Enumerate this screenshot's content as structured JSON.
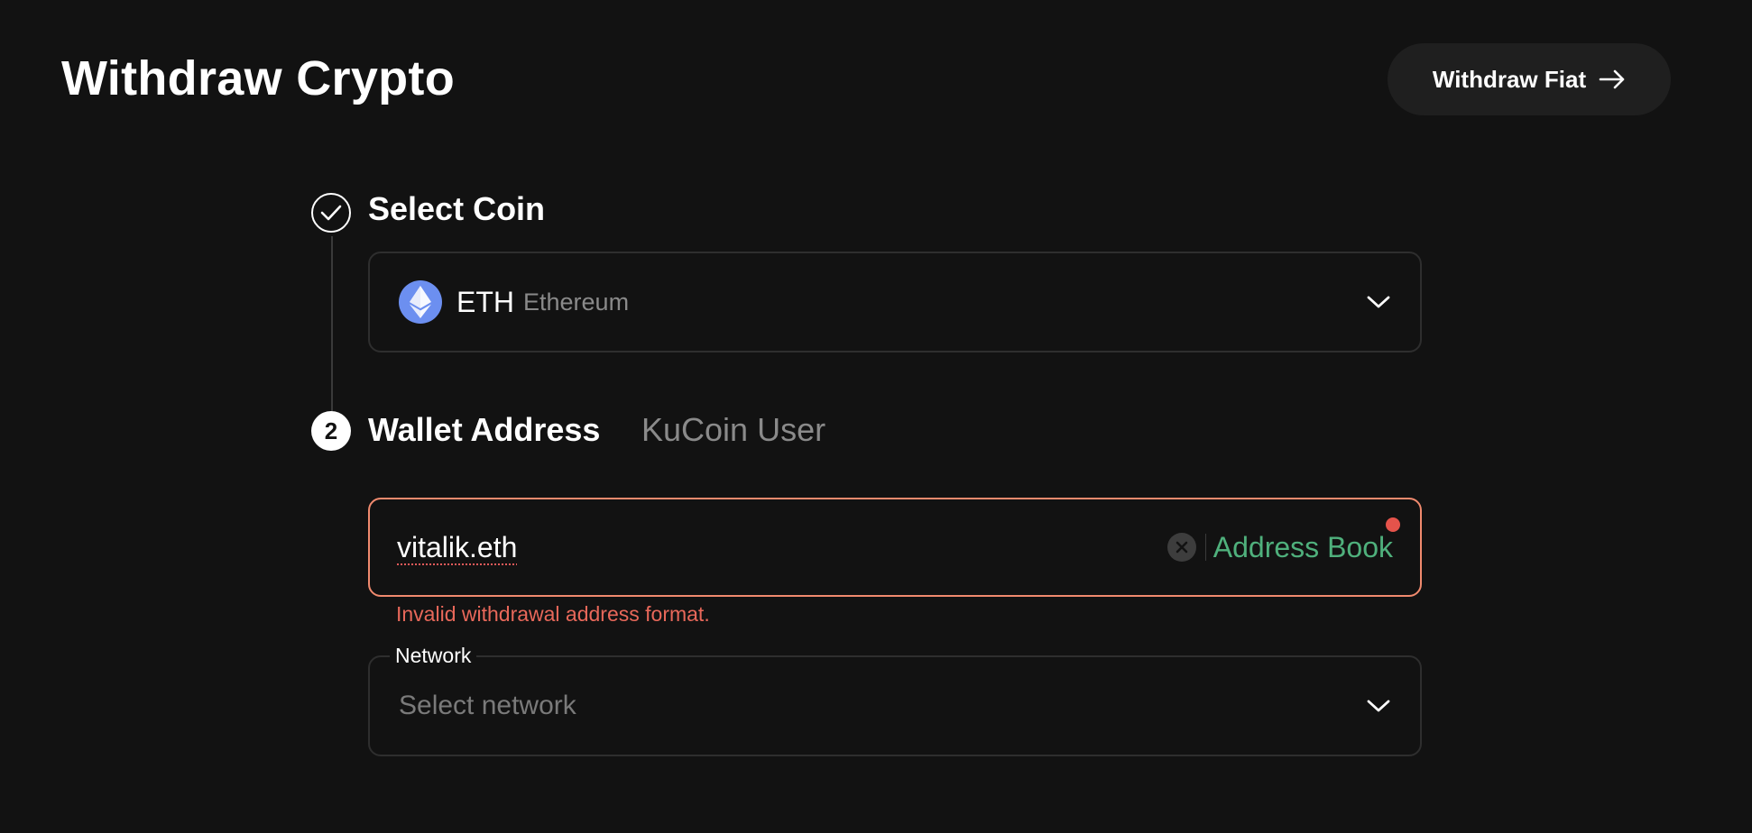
{
  "header": {
    "title": "Withdraw Crypto",
    "fiat_button_label": "Withdraw Fiat"
  },
  "steps": {
    "step1": {
      "title": "Select Coin",
      "status": "completed",
      "coin_symbol": "ETH",
      "coin_name": "Ethereum"
    },
    "step2": {
      "number": "2",
      "title": "Wallet Address",
      "alt_tab": "KuCoin User",
      "address_value": "vitalik.eth",
      "address_book_label": "Address Book",
      "error": "Invalid withdrawal address format."
    }
  },
  "network": {
    "label": "Network",
    "placeholder": "Select network"
  },
  "colors": {
    "background": "#121212",
    "accent_green": "#4fb07c",
    "error_red": "#e8685a",
    "eth_blue": "#6c8ff0"
  },
  "icons": {
    "fiat_button": "arrow-right-icon",
    "step1": "check-icon",
    "coin": "ethereum-icon",
    "dropdown": "chevron-down-icon",
    "clear": "close-icon"
  }
}
